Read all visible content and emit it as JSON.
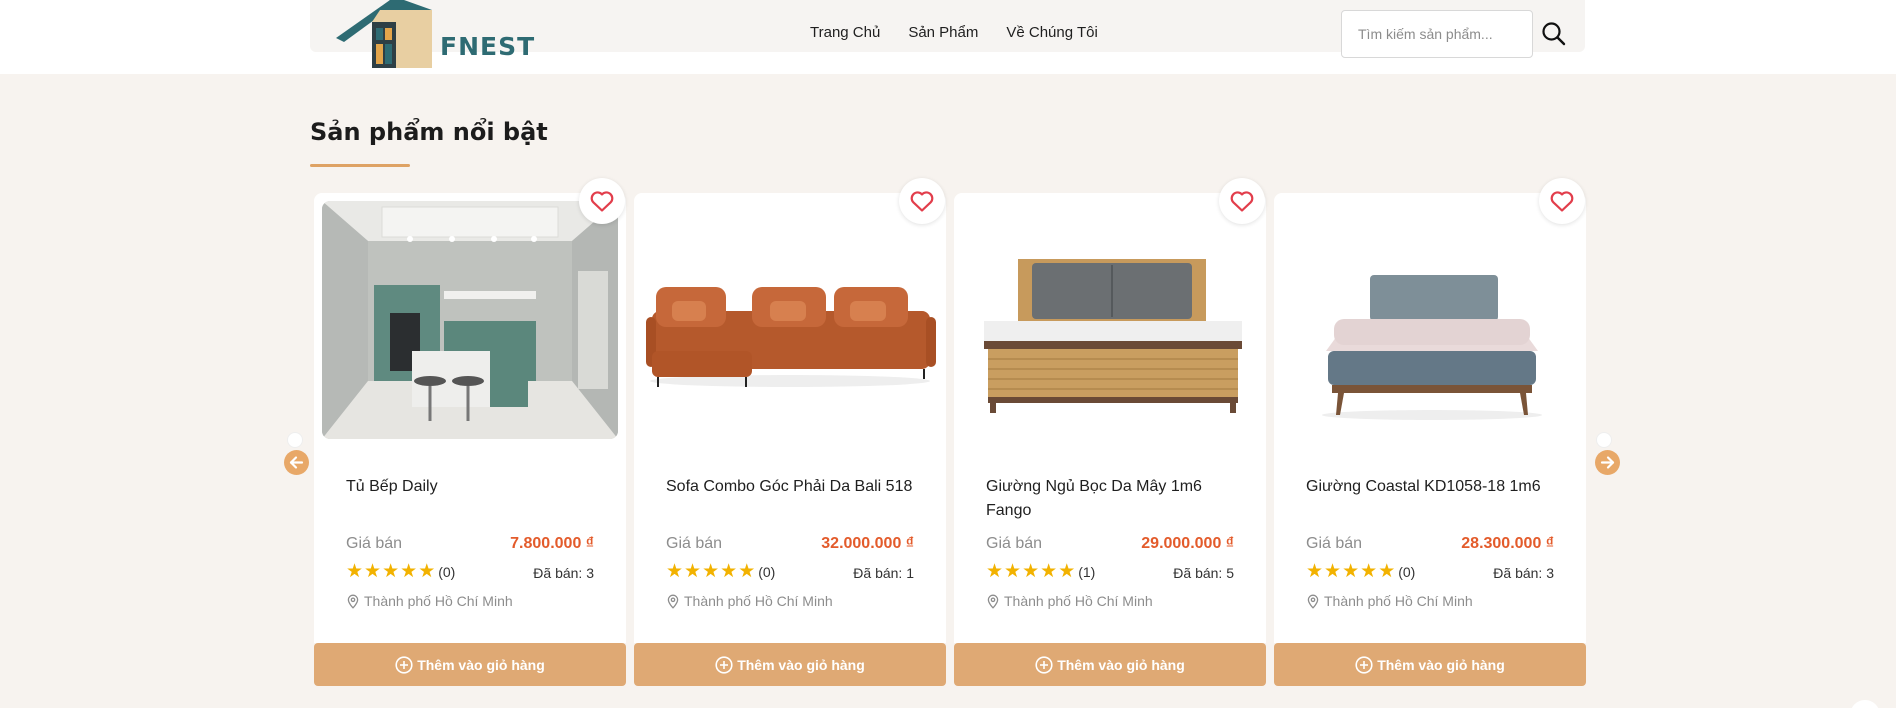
{
  "brand": {
    "name": "FNEST"
  },
  "nav": {
    "items": [
      "Trang Chủ",
      "Sản Phẩm",
      "Về Chúng Tôi"
    ]
  },
  "search": {
    "placeholder": "Tìm kiếm sản phẩm..."
  },
  "section": {
    "title": "Sản phẩm nổi bật"
  },
  "colors": {
    "accent": "#dfa974",
    "price": "#e35b2b",
    "star": "#f2b200",
    "logo": "#2e6b73"
  },
  "products": [
    {
      "name": "Tủ Bếp Daily",
      "price_label": "Giá bán",
      "price": "7.800.000 ₫",
      "rating_count": "(0)",
      "sold": "Đã bán: 3",
      "location": "Thành phố Hồ Chí Minh",
      "add_label": "Thêm vào giỏ hàng",
      "image": "kitchen-image"
    },
    {
      "name": "Sofa Combo Góc Phải Da Bali 518",
      "price_label": "Giá bán",
      "price": "32.000.000 ₫",
      "rating_count": "(0)",
      "sold": "Đã bán: 1",
      "location": "Thành phố Hồ Chí Minh",
      "add_label": "Thêm vào giỏ hàng",
      "image": "sofa-image"
    },
    {
      "name": "Giường Ngủ Bọc Da Mây 1m6 Fango",
      "price_label": "Giá bán",
      "price": "29.000.000 ₫",
      "rating_count": "(1)",
      "sold": "Đã bán: 5",
      "location": "Thành phố Hồ Chí Minh",
      "add_label": "Thêm vào giỏ hàng",
      "image": "rattan-bed-image"
    },
    {
      "name": "Giường Coastal KD1058-18 1m6",
      "price_label": "Giá bán",
      "price": "28.300.000 ₫",
      "rating_count": "(0)",
      "sold": "Đã bán: 3",
      "location": "Thành phố Hồ Chí Minh",
      "add_label": "Thêm vào giỏ hàng",
      "image": "coastal-bed-image"
    }
  ]
}
